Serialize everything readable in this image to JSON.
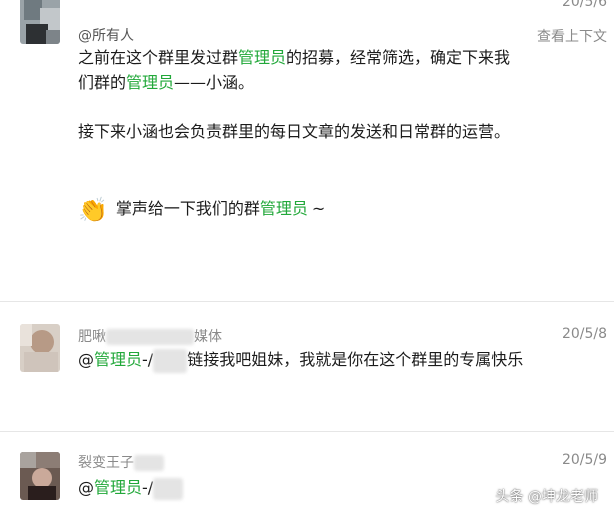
{
  "messages": [
    {
      "mention": "@所有人",
      "date": "20/5/6",
      "view_context": "查看上下文",
      "p1": {
        "a": "之前在这个群里发过群",
        "hl1": "管理员",
        "b": "的招募，经常筛选，确定下来我们群的",
        "hl2": "管理员",
        "c": "——小涵。"
      },
      "p2": "接下来小涵也会负责群里的每日文章的发送和日常群的运营。",
      "p3": {
        "emoji": "👏",
        "a": "掌声给一下我们的群",
        "hl": "管理员",
        "b": "~"
      }
    },
    {
      "sender_prefix": "肥啾",
      "sender_suffix": "媒体",
      "date": "20/5/8",
      "at": "@",
      "hl": "管理员",
      "dash": "-/",
      "text": "链接我吧姐妹，我就是你在这个群里的专属快乐"
    },
    {
      "sender_prefix": "裂变王子",
      "date": "20/5/9",
      "at": "@",
      "hl": "管理员",
      "dash": "-/"
    }
  ],
  "watermark": "头条 @坤龙老师",
  "colors": {
    "highlight": "#22a83a",
    "meta": "#8a8a8a",
    "text": "#1b1b1b",
    "divider": "#e6e6e6"
  }
}
